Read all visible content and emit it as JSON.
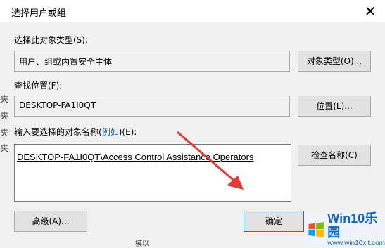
{
  "window": {
    "title": "选择用户或组"
  },
  "object_type": {
    "label": "选择此对象类型(S):",
    "value": "用户、组或内置安全主体",
    "button": "对象类型(O)..."
  },
  "location": {
    "label": "查找位置(F):",
    "value": "DESKTOP-FA1I0QT",
    "button": "位置(L)..."
  },
  "names": {
    "label_prefix": "输入要选择的对象名称(",
    "label_link": "例如",
    "label_suffix": ")(E):",
    "value": "DESKTOP-FA1I0QT\\Access Control Assistance Operators",
    "button": "检查名称(C)"
  },
  "footer": {
    "advanced": "高级(A)...",
    "ok": "确定"
  },
  "background": {
    "ghost_chars": [
      "夹",
      "夹",
      "夹",
      "夹"
    ],
    "ghost_bottom": "模以"
  },
  "watermark": {
    "brand": "Win10乐园",
    "url": "www.win10xit.com"
  },
  "colors": {
    "accent": "#0078d7",
    "arrow": "#e53935",
    "link": "#0066cc"
  }
}
